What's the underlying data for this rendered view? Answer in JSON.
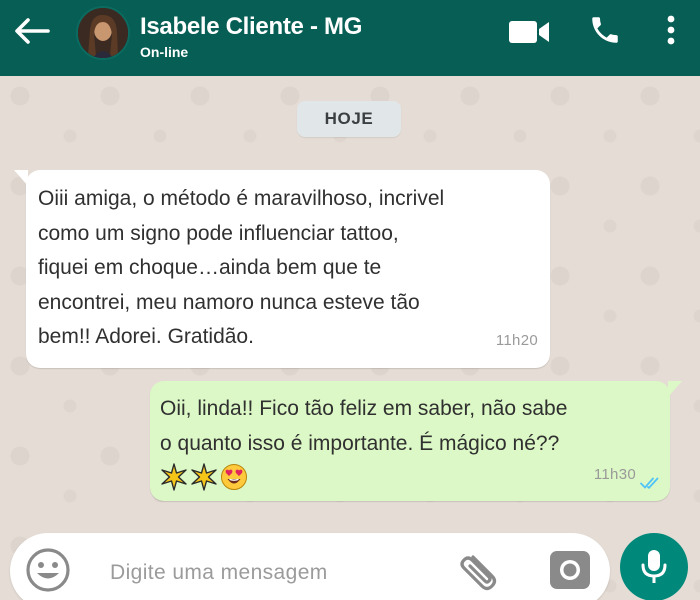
{
  "colors": {
    "header": "#075e54",
    "outgoing_bubble": "#dcf8c6",
    "mic_button": "#00897b",
    "read_ticks": "#4fc3f7"
  },
  "header": {
    "contact_name": "Isabele Cliente - MG",
    "status": "On-line",
    "icons": [
      "back-arrow-icon",
      "avatar",
      "video-call-icon",
      "phone-icon",
      "more-vertical-icon"
    ]
  },
  "chat": {
    "date_separator": "HOJE",
    "messages": [
      {
        "direction": "incoming",
        "text": "Oiii amiga, o método é maravilhoso, incrivel\ncomo um signo pode influenciar tattoo,\nfiquei em choque…ainda bem que te\nencontrei, meu namoro nunca esteve tão\nbem!! Adorei. Gratidão.",
        "time": "11h20"
      },
      {
        "direction": "outgoing",
        "text": "Oii, linda!! Fico tão feliz em saber, não sabe\no quanto isso é importante. É mágico né??",
        "emojis": [
          "sparkle-star-icon",
          "sparkle-star-icon",
          "heart-eyes-emoji-icon"
        ],
        "time": "11h30",
        "status": "read"
      }
    ]
  },
  "composer": {
    "placeholder": "Digite uma mensagem"
  }
}
